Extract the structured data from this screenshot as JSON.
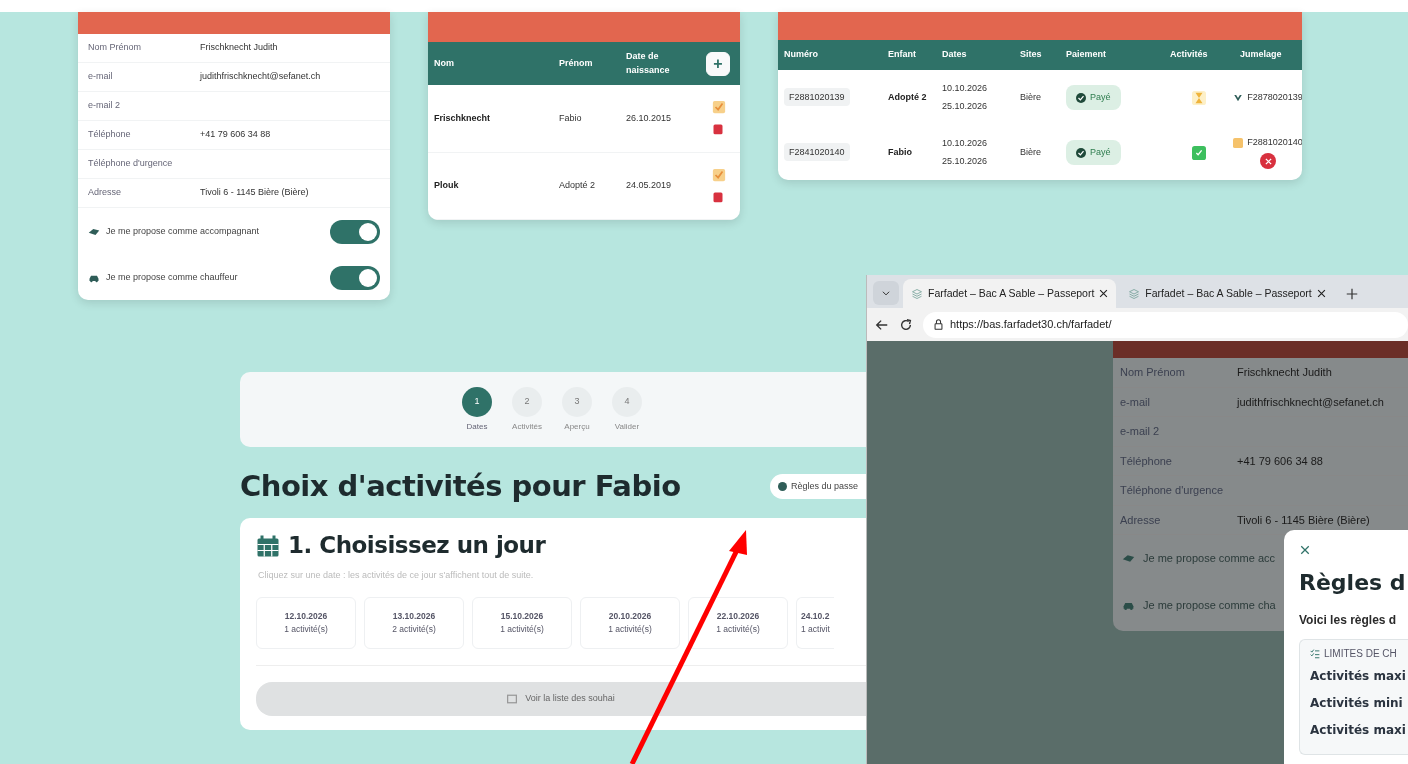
{
  "profile_card": {
    "fields": [
      {
        "label": "Nom Prénom",
        "value": "Frischknecht Judith"
      },
      {
        "label": "e-mail",
        "value": "judithfrischknecht@sefanet.ch"
      },
      {
        "label": "e-mail 2"
      },
      {
        "label": "Téléphone",
        "value": "+41 79 606 34 88"
      },
      {
        "label": "Téléphone d'urgence"
      },
      {
        "label": "Adresse",
        "value": "Tivoli 6 - 1145 Bière (Bière)"
      }
    ],
    "toggles": [
      {
        "kind": "companion",
        "label": "Je me propose comme accompagnant",
        "on": true
      },
      {
        "kind": "driver",
        "label": "Je me propose comme chauffeur",
        "on": true
      }
    ]
  },
  "children_card": {
    "columns": [
      "Nom",
      "Prénom",
      "Date de naissance"
    ],
    "add_button": "+",
    "rows": [
      {
        "last_name": "Frischknecht",
        "first_name": "Fabio",
        "birth_date": "26.10.2015"
      },
      {
        "last_name": "Plouk",
        "first_name": "Adopté 2",
        "birth_date": "24.05.2019"
      }
    ]
  },
  "passports_card": {
    "columns": [
      "Numéro",
      "Enfant",
      "Dates",
      "Sites",
      "Paiement",
      "Activités",
      "Jumelage"
    ],
    "rows": [
      {
        "number": "F2881020139",
        "child": "Adopté 2",
        "date_from": "10.10.2026",
        "date_to": "25.10.2026",
        "site": "Bière",
        "payment": "Payé",
        "activities_complete": false,
        "twin_confirmed": true,
        "twin": "F2878020139",
        "removable": false
      },
      {
        "number": "F2841020140",
        "child": "Fabio",
        "date_from": "10.10.2026",
        "date_to": "25.10.2026",
        "site": "Bière",
        "payment": "Payé",
        "activities_complete": true,
        "twin_confirmed": false,
        "twin": "F2881020140",
        "removable": true
      }
    ]
  },
  "stepper": {
    "steps": [
      {
        "number": "1",
        "label": "Dates",
        "selected": true
      },
      {
        "number": "2",
        "label": "Activités",
        "selected": false
      },
      {
        "number": "3",
        "label": "Aperçu",
        "selected": false
      },
      {
        "number": "4",
        "label": "Valider",
        "selected": false
      }
    ]
  },
  "page_title": "Choix d'activités pour Fabio",
  "rules_button": "Règles du passe",
  "day_picker": {
    "title": "1. Choisissez un jour",
    "hint": "Cliquez sur une date : les activités de ce jour s'affichent tout de suite.",
    "days": [
      {
        "date": "12.10.2026",
        "count": "1 activité(s)"
      },
      {
        "date": "13.10.2026",
        "count": "2 activité(s)"
      },
      {
        "date": "15.10.2026",
        "count": "1 activité(s)"
      },
      {
        "date": "20.10.2026",
        "count": "1 activité(s)"
      },
      {
        "date": "22.10.2026",
        "count": "1 activité(s)"
      },
      {
        "date": "24.10.2",
        "count": "1 activit"
      }
    ],
    "wishlist_button": "Voir la liste des souhai"
  },
  "browser": {
    "tabs": [
      {
        "title": "Farfadet – Bac A Sable – Passeport",
        "selected": true
      },
      {
        "title": "Farfadet – Bac A Sable – Passeport",
        "selected": false
      }
    ],
    "url": "https://bas.farfadet30.ch/farfadet/",
    "profile": {
      "fields": [
        {
          "label": "Nom Prénom",
          "value": "Frischknecht Judith"
        },
        {
          "label": "e-mail",
          "value": "judithfrischknecht@sefanet.ch"
        },
        {
          "label": "e-mail 2"
        },
        {
          "label": "Téléphone",
          "value": "+41 79 606 34 88"
        },
        {
          "label": "Téléphone d'urgence"
        },
        {
          "label": "Adresse",
          "value": "Tivoli 6 - 1145 Bière (Bière)"
        }
      ],
      "toggles": [
        {
          "kind": "companion",
          "label": "Je me propose comme acc"
        },
        {
          "kind": "driver",
          "label": "Je me propose comme cha"
        }
      ]
    },
    "modal": {
      "title": "Règles d",
      "intro": "Voici les règles d",
      "section_title": "LIMITES DE CH",
      "items": [
        "Activités maxi",
        "Activités mini",
        "Activités maxi"
      ]
    }
  }
}
